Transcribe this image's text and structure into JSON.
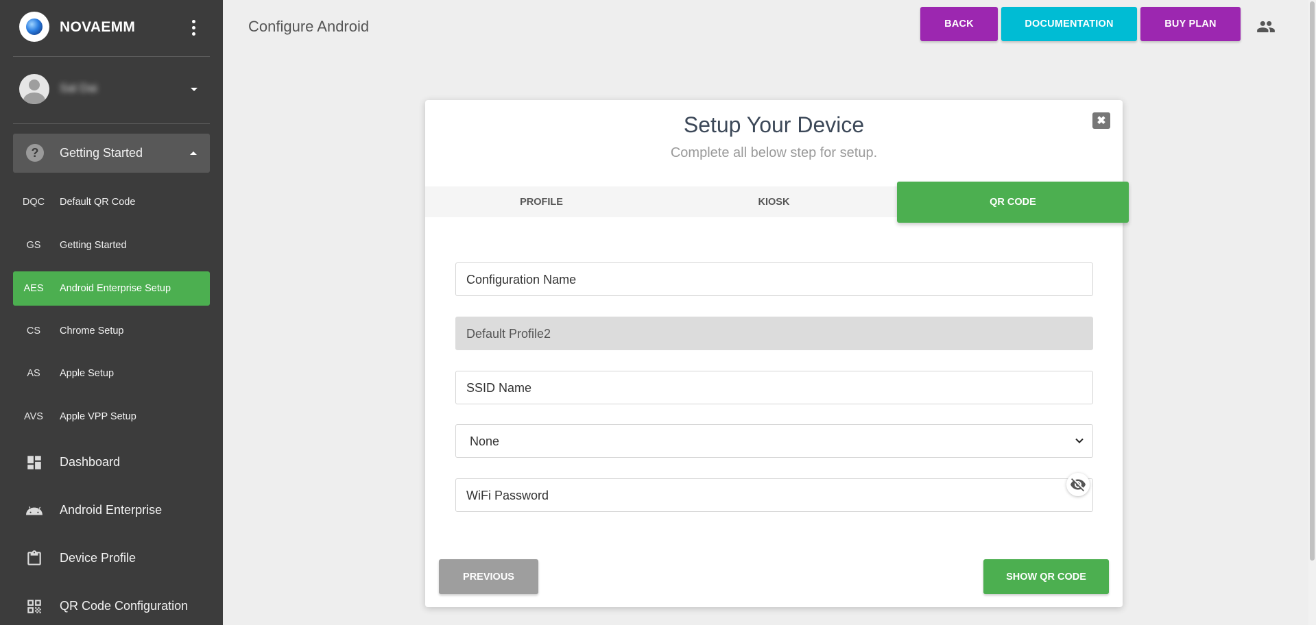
{
  "sidebar": {
    "brand": "NOVAEMM",
    "user_name": "Sal Dai",
    "section": {
      "label": "Getting Started",
      "icon": "help-circle-icon"
    },
    "sub_items": [
      {
        "abbr": "DQC",
        "label": "Default QR Code",
        "active": false
      },
      {
        "abbr": "GS",
        "label": "Getting Started",
        "active": false
      },
      {
        "abbr": "AES",
        "label": "Android Enterprise Setup",
        "active": true
      },
      {
        "abbr": "CS",
        "label": "Chrome Setup",
        "active": false
      },
      {
        "abbr": "AS",
        "label": "Apple Setup",
        "active": false
      },
      {
        "abbr": "AVS",
        "label": "Apple VPP Setup",
        "active": false
      }
    ],
    "main_items": [
      {
        "label": "Dashboard",
        "icon": "dashboard-icon"
      },
      {
        "label": "Android Enterprise",
        "icon": "android-icon"
      },
      {
        "label": "Device Profile",
        "icon": "clipboard-icon"
      },
      {
        "label": "QR Code Configuration",
        "icon": "qr-code-icon"
      }
    ]
  },
  "header": {
    "title": "Configure Android",
    "back_label": "BACK",
    "documentation_label": "DOCUMENTATION",
    "buy_plan_label": "BUY PLAN"
  },
  "modal": {
    "title": "Setup Your Device",
    "subtitle": "Complete all below step for setup.",
    "tabs": [
      {
        "label": "PROFILE",
        "active": false
      },
      {
        "label": "KIOSK",
        "active": false
      },
      {
        "label": "QR CODE",
        "active": true
      }
    ],
    "fields": {
      "configuration_name": "Configuration Name",
      "profile": "Default Profile2",
      "ssid_name": "SSID Name",
      "security_select": "None",
      "wifi_password": "WiFi Password"
    },
    "previous_label": "PREVIOUS",
    "show_qr_label": "SHOW QR CODE"
  },
  "colors": {
    "sidebar_bg": "#3c3c3c",
    "active_green": "#4caf50",
    "purple": "#9c27b0",
    "cyan": "#00bcd4"
  }
}
